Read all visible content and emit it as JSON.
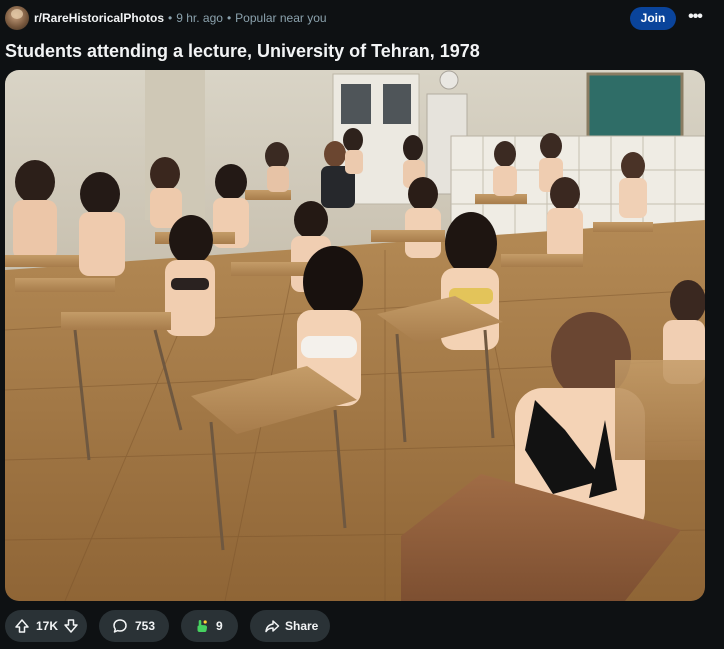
{
  "post": {
    "subreddit": "r/RareHistoricalPhotos",
    "age": "9 hr. ago",
    "context": "Popular near you",
    "join_label": "Join",
    "title": "Students attending a lecture, University of Tehran, 1978",
    "media_alt": ""
  },
  "actions": {
    "vote_count": "17K",
    "comment_count": "753",
    "award_count": "9",
    "share_label": "Share"
  },
  "icons": {
    "more": "more-options-icon",
    "upvote": "upvote-arrow-icon",
    "downvote": "downvote-arrow-icon",
    "comment": "comment-bubble-icon",
    "award": "award-hand-icon",
    "share": "share-arrow-icon"
  },
  "colors": {
    "background": "#0e1113",
    "join_button": "#0a449b",
    "pill": "#2a3236",
    "muted_text": "#8ba2ad",
    "award_green": "#46d160"
  }
}
